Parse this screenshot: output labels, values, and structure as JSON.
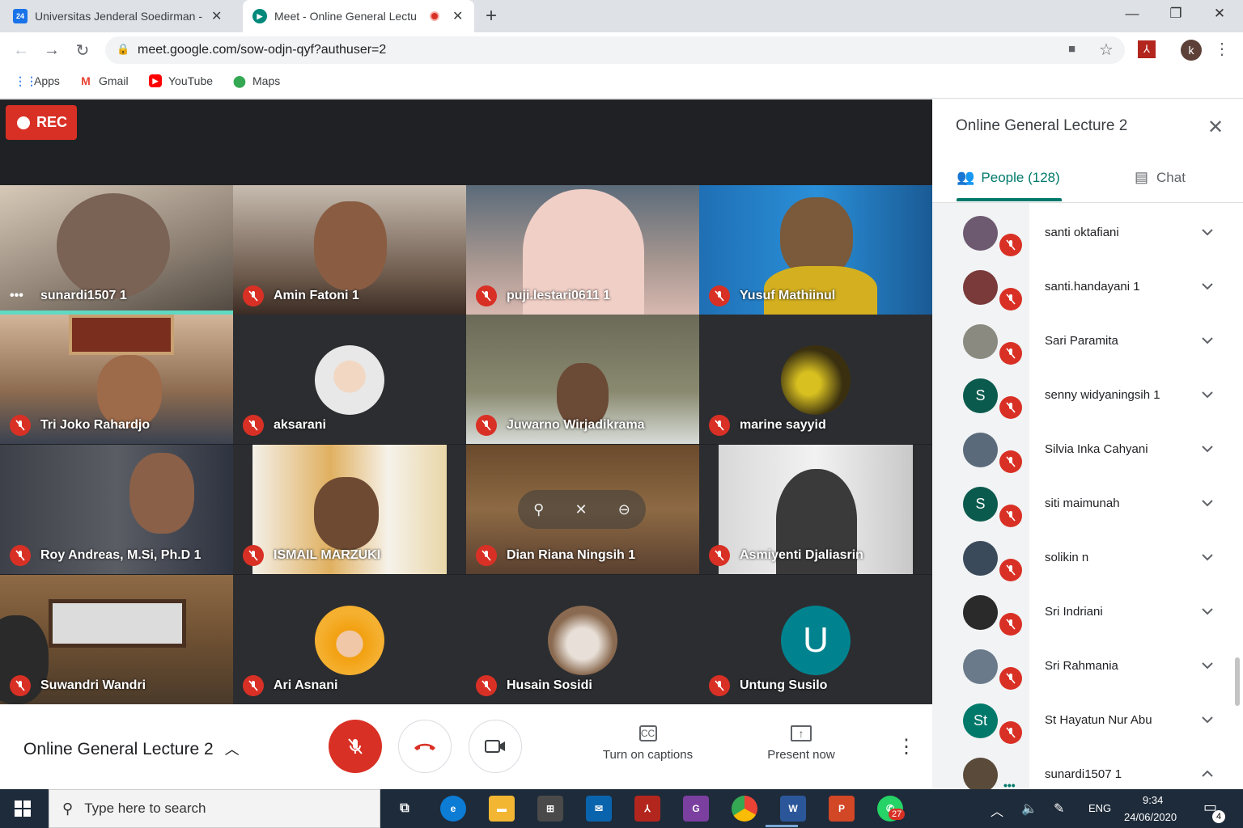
{
  "browser": {
    "tabs": [
      {
        "title": "Universitas Jenderal Soedirman -",
        "favicon_text": "24",
        "active": false
      },
      {
        "title": "Meet - Online General Lectu",
        "active": true
      }
    ],
    "url": "meet.google.com/sow-odjn-qyf?authuser=2",
    "profile_initial": "k",
    "bookmarks": [
      {
        "label": "Apps",
        "icon": "apps-grid-icon"
      },
      {
        "label": "Gmail",
        "icon": "gmail-icon"
      },
      {
        "label": "YouTube",
        "icon": "youtube-icon"
      },
      {
        "label": "Maps",
        "icon": "maps-icon"
      }
    ]
  },
  "meet": {
    "rec_label": "REC",
    "meeting_title": "Online General Lecture 2",
    "captions_label": "Turn on captions",
    "present_label": "Present now",
    "tiles": [
      {
        "name": "sunardi1507 1",
        "speaking": true
      },
      {
        "name": "Amin Fatoni 1"
      },
      {
        "name": "puji.lestari0611 1"
      },
      {
        "name": "Yusuf Mathiinul"
      },
      {
        "name": "Tri Joko Rahardjo"
      },
      {
        "name": "aksarani"
      },
      {
        "name": "Juwarno Wirjadikrama"
      },
      {
        "name": "marine sayyid"
      },
      {
        "name": "Roy Andreas, M.Si, Ph.D 1"
      },
      {
        "name": "ISMAIL MARZUKI"
      },
      {
        "name": "Dian Riana Ningsih 1"
      },
      {
        "name": "Asmiyenti Djaliasrin"
      },
      {
        "name": "Suwandri Wandri"
      },
      {
        "name": "Ari Asnani"
      },
      {
        "name": "Husain Sosidi"
      },
      {
        "name": "Untung Susilo",
        "avatar_letter": "U"
      }
    ]
  },
  "panel": {
    "title": "Online General Lecture 2",
    "people_tab": "People (128)",
    "chat_tab": "Chat",
    "people": [
      {
        "name": "santi oktafiani"
      },
      {
        "name": "santi.handayani 1"
      },
      {
        "name": "Sari Paramita"
      },
      {
        "name": "senny widyaningsih 1",
        "initial": "S"
      },
      {
        "name": "Silvia Inka Cahyani"
      },
      {
        "name": "siti maimunah",
        "initial": "S"
      },
      {
        "name": "solikin n"
      },
      {
        "name": "Sri Indriani"
      },
      {
        "name": "Sri Rahmania"
      },
      {
        "name": "St Hayatun Nur Abu",
        "initial": "St"
      },
      {
        "name": "sunardi1507 1"
      }
    ]
  },
  "taskbar": {
    "search_placeholder": "Type here to search",
    "language": "ENG",
    "time": "9:34",
    "date": "24/06/2020",
    "whatsapp_badge": "27",
    "notifications": "4"
  },
  "colors": {
    "red": "#d93025",
    "meet_green": "#00796b",
    "dark_bg": "#202124",
    "teal_avatar": "#00838f"
  }
}
